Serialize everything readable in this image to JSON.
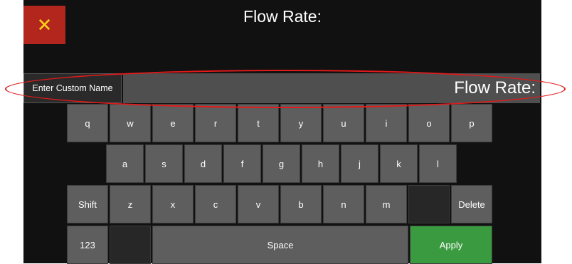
{
  "header": {
    "title": "Flow Rate:",
    "close_symbol": "✕"
  },
  "name_entry": {
    "label": "Enter Custom Name",
    "value": "Flow Rate:"
  },
  "keyboard": {
    "row1": [
      "q",
      "w",
      "e",
      "r",
      "t",
      "y",
      "u",
      "i",
      "o",
      "p"
    ],
    "row2": [
      "a",
      "s",
      "d",
      "f",
      "g",
      "h",
      "j",
      "k",
      "l"
    ],
    "row3_shift": "Shift",
    "row3": [
      "z",
      "x",
      "c",
      "v",
      "b",
      "n",
      "m"
    ],
    "row3_delete": "Delete",
    "numbers": "123",
    "space": "Space",
    "apply": "Apply"
  },
  "colors": {
    "close_bg": "#b3261e",
    "close_icon": "#ffd21a",
    "apply_bg": "#3a9a3f",
    "highlight": "#e11a1a",
    "key_bg": "#5e5e5e"
  }
}
